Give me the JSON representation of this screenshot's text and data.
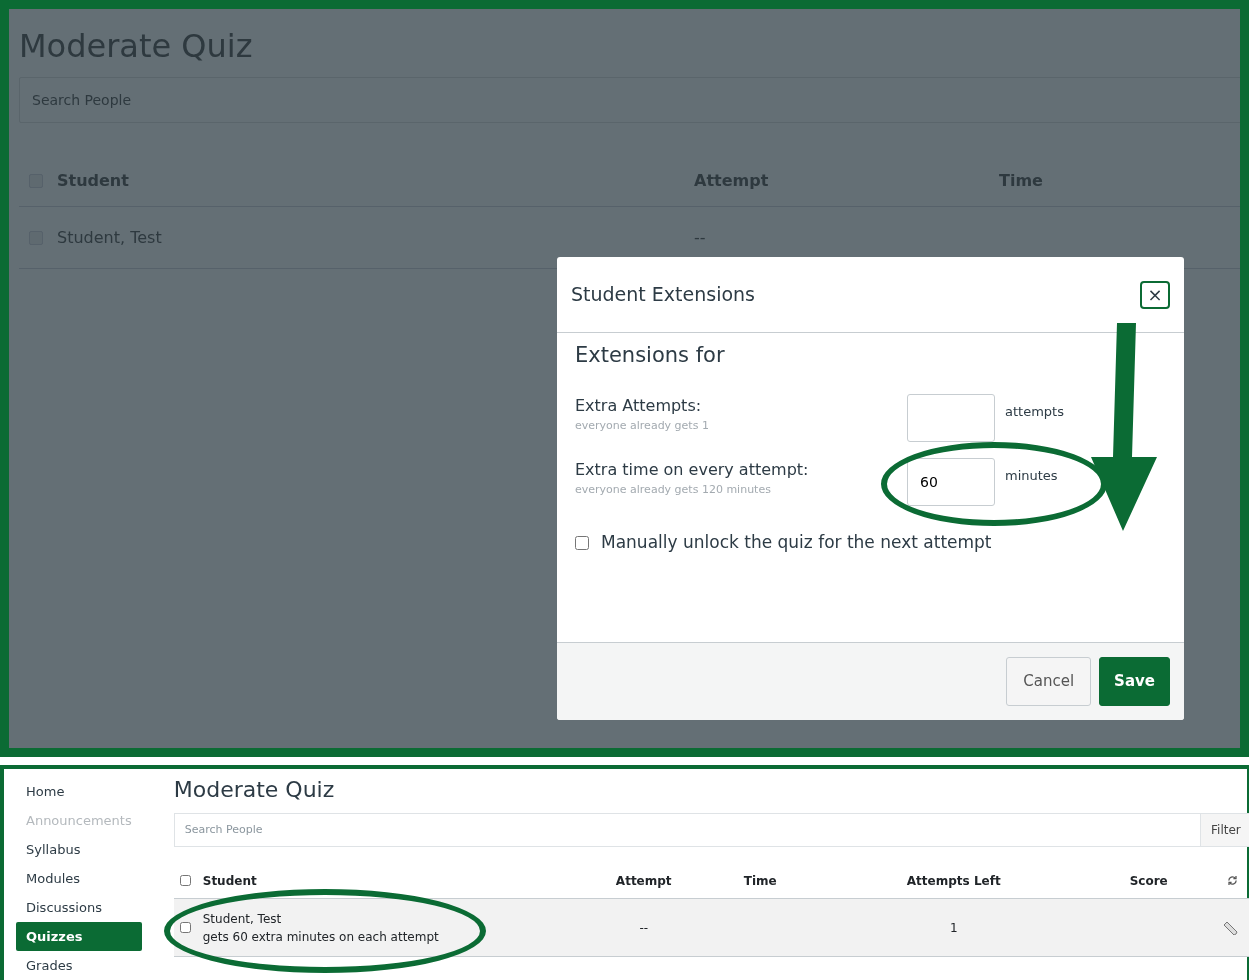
{
  "background_page": {
    "title": "Moderate Quiz",
    "search": {
      "placeholder": "Search People"
    },
    "table": {
      "header_checked": false,
      "columns": [
        "Student",
        "Attempt",
        "Time"
      ],
      "rows": [
        {
          "checked": false,
          "student": "Student, Test",
          "attempt": "--"
        }
      ]
    }
  },
  "dialog": {
    "title": "Student Extensions",
    "close": "×",
    "heading": "Extensions for",
    "fields": [
      {
        "label": "Extra Attempts:",
        "hint": "everyone already gets 1",
        "unit": "attempts",
        "highlighted": false
      },
      {
        "label": "Extra time on every attempt:",
        "hint": "everyone already gets 120 minutes",
        "value": "60",
        "unit": "minutes",
        "highlighted": true
      }
    ],
    "unlock": {
      "label": "Manually unlock the quiz for the next attempt",
      "checked": false
    },
    "buttons": [
      {
        "label": "Cancel",
        "kind": "secondary",
        "pointed_at": false
      },
      {
        "label": "Save",
        "kind": "primary",
        "pointed_at": true
      }
    ]
  },
  "result_page": {
    "sidebar": [
      {
        "label": "Home",
        "selected": false,
        "disabled": false
      },
      {
        "label": "Announcements",
        "selected": false,
        "disabled": true
      },
      {
        "label": "Syllabus",
        "selected": false,
        "disabled": false
      },
      {
        "label": "Modules",
        "selected": false,
        "disabled": false
      },
      {
        "label": "Discussions",
        "selected": false,
        "disabled": false
      },
      {
        "label": "Quizzes",
        "selected": true,
        "disabled": false
      },
      {
        "label": "Grades",
        "selected": false,
        "disabled": false
      }
    ],
    "title": "Moderate Quiz",
    "search": {
      "placeholder": "Search People"
    },
    "filter_button": "Filter",
    "table": {
      "header_checked": false,
      "columns": [
        "Student",
        "Attempt",
        "Time",
        "Attempts Left",
        "Score"
      ],
      "rows": [
        {
          "checked": false,
          "student": "Student, Test",
          "note": "gets 60 extra minutes on each attempt",
          "attempt": "--",
          "time": "",
          "attempts_left": "1",
          "score": "",
          "highlighted": true
        }
      ]
    }
  }
}
